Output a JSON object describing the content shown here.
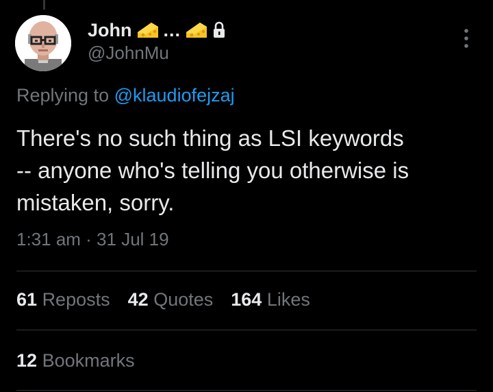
{
  "author": {
    "display_name": "John",
    "ellipsis": "...",
    "handle": "@JohnMu",
    "name_emoji": "cheese-wedge-icon"
  },
  "reply": {
    "prefix": "Replying to",
    "mention": "@klaudiofejzaj"
  },
  "tweet": {
    "text": "There's no such thing as LSI keywords\n-- anyone who's telling you otherwise is\nmistaken, sorry.",
    "timestamp": "1:31 am · 31 Jul 19"
  },
  "stats": {
    "reposts_count": "61",
    "reposts_label": "Reposts",
    "quotes_count": "42",
    "quotes_label": "Quotes",
    "likes_count": "164",
    "likes_label": "Likes",
    "bookmarks_count": "12",
    "bookmarks_label": "Bookmarks"
  },
  "colors": {
    "background": "#000000",
    "text_primary": "#e7e9ea",
    "text_secondary": "#71767b",
    "link": "#1d9bf0",
    "divider": "#2f3336"
  }
}
